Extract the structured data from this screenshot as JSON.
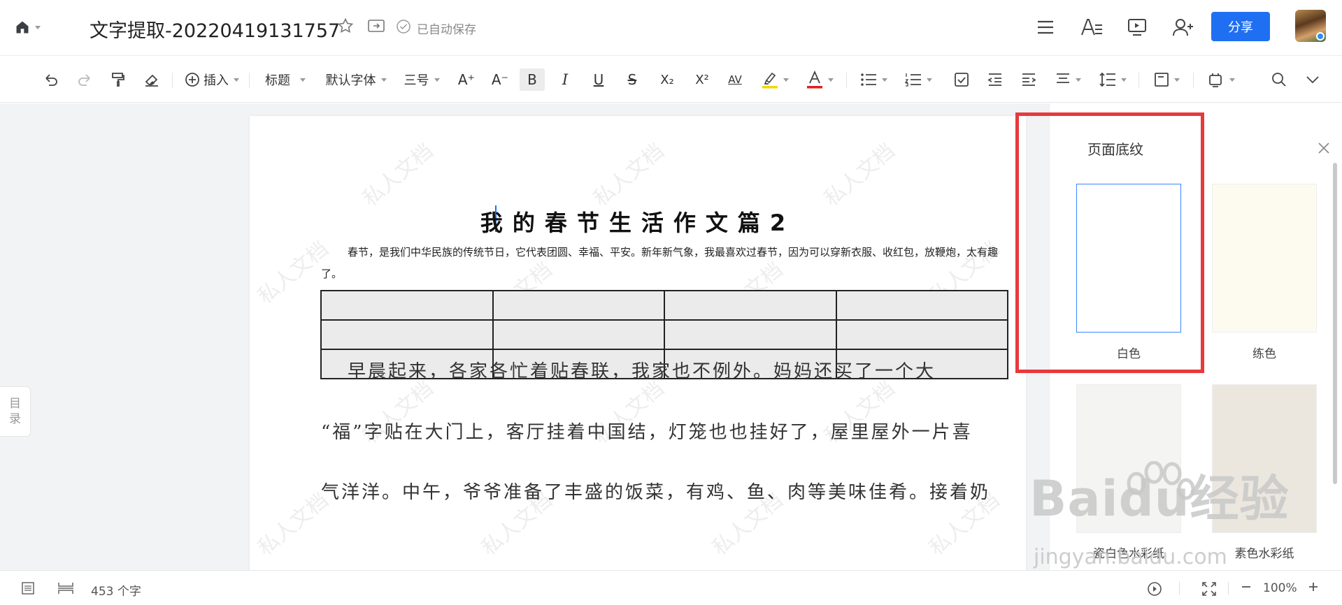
{
  "header": {
    "title": "文字提取-20220419131757",
    "saved_status": "已自动保存",
    "share_label": "分享",
    "icons": [
      "home-icon",
      "star-icon",
      "move-to-folder-icon",
      "saved-check-icon",
      "menu-icon",
      "text-style-icon",
      "presentation-icon",
      "add-collaborator-icon"
    ]
  },
  "toolbar": {
    "insert_label": "插入",
    "heading_style": "标题",
    "font_family": "默认字体",
    "font_size": "三号",
    "grow_font": "A⁺",
    "shrink_font": "A⁻",
    "bold": "B",
    "italic": "I",
    "underline": "U",
    "strikethrough": "S",
    "subscript": "X₂",
    "superscript": "X²",
    "spacing": "AV",
    "highlight_color": "#f5d800",
    "font_color": "#e02020"
  },
  "sidebar": {
    "toc_label_1": "目",
    "toc_label_2": "录"
  },
  "document": {
    "title": "我的春节生活作文篇2",
    "intro": "春节，是我们中华民族的传统节日，它代表团圆、幸福、平安。新年新气象，我最喜欢过春节，因为可以穿新衣服、收红包，放鞭炮，太有趣了。",
    "table": {
      "rows": 3,
      "cols": 4
    },
    "paragraph_lines": [
      "早晨起来，各家各忙着贴春联，我家也不例外。妈妈还买了一个大",
      "“福”字贴在大门上，客厅挂着中国结，灯笼也也挂好了，屋里屋外一片喜",
      "气洋洋。中午，爷爷准备了丰盛的饭菜，有鸡、鱼、肉等美味佳肴。接着奶"
    ],
    "watermark_text": "私人文档"
  },
  "panel": {
    "title": "页面底纹",
    "options": [
      {
        "label": "白色",
        "color": "#ffffff",
        "selected": true
      },
      {
        "label": "练色",
        "color": "#fdfaf0",
        "selected": false
      },
      {
        "label": "瓷白色水彩纸",
        "color": "#f4f4f2",
        "selected": false
      },
      {
        "label": "素色水彩纸",
        "color": "#ebe7df",
        "selected": false
      }
    ],
    "highlight_color": "#e8393c"
  },
  "statusbar": {
    "word_count": "453 个字",
    "zoom": "100%"
  },
  "overlay": {
    "baidu_logo": "Baidu经验",
    "baidu_url": "jingyan.baidu.com"
  }
}
